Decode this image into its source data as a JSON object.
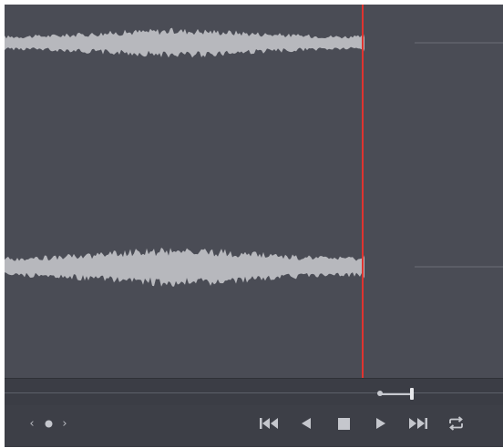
{
  "colors": {
    "background": "#4a4c55",
    "waveform": "#b7b8bd",
    "playhead": "#e0342f",
    "controls": "#c5c7cd",
    "panel_bg": "#3d3f47"
  },
  "timeline": {
    "playhead_position": 0.73,
    "zoom_level": 0.6
  },
  "navigation": {
    "prev_symbol": "‹",
    "next_symbol": "›",
    "dot_icon": "dot-icon"
  },
  "transport": {
    "buttons": [
      {
        "name": "go-to-start",
        "icon": "skip-to-start-icon"
      },
      {
        "name": "play-reverse",
        "icon": "play-reverse-icon"
      },
      {
        "name": "stop",
        "icon": "stop-icon"
      },
      {
        "name": "play",
        "icon": "play-icon"
      },
      {
        "name": "go-to-end",
        "icon": "skip-to-end-icon"
      },
      {
        "name": "loop",
        "icon": "loop-icon"
      }
    ]
  }
}
